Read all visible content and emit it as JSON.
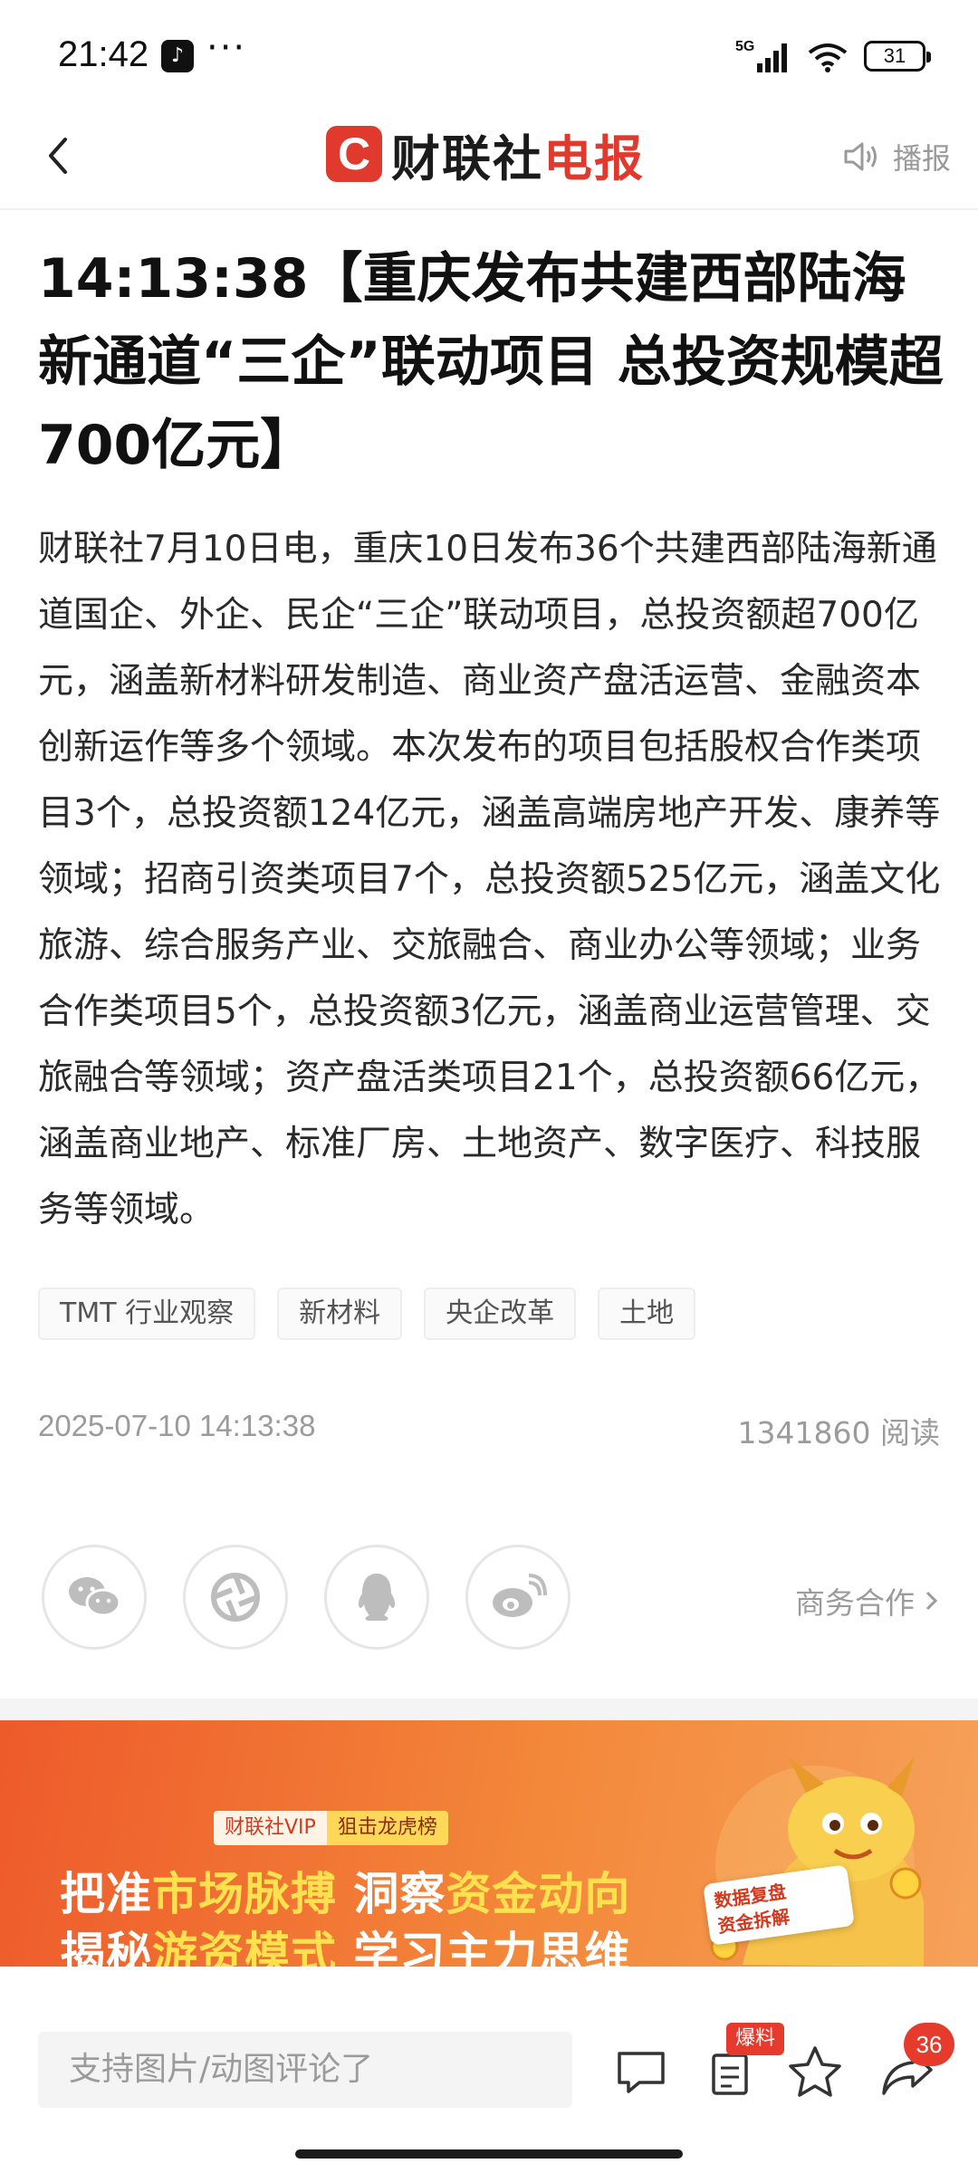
{
  "status_bar": {
    "time": "21:42",
    "tiktok_glyph": "♪",
    "dots": "···",
    "network": "5G",
    "battery": "31"
  },
  "header": {
    "logo_c": "C",
    "logo_main": "财联社",
    "logo_accent": "电报",
    "broadcast_label": "播报"
  },
  "article": {
    "title": "14:13:38【重庆发布共建西部陆海新通道“三企”联动项目 总投资规模超700亿元】",
    "body": "财联社7月10日电，重庆10日发布36个共建西部陆海新通道国企、外企、民企“三企”联动项目，总投资额超700亿元，涵盖新材料研发制造、商业资产盘活运营、金融资本创新运作等多个领域。本次发布的项目包括股权合作类项目3个，总投资额124亿元，涵盖高端房地产开发、康养等领域；招商引资类项目7个，总投资额525亿元，涵盖文化旅游、综合服务产业、交旅融合、商业办公等领域；业务合作类项目5个，总投资额3亿元，涵盖商业运营管理、交旅融合等领域；资产盘活类项目21个，总投资额66亿元，涵盖商业地产、标准厂房、土地资产、数字医疗、科技服务等领域。",
    "tags": [
      "TMT 行业观察",
      "新材料",
      "央企改革",
      "土地"
    ],
    "datetime": "2025-07-10 14:13:38",
    "reads": "1341860 阅读",
    "business_link": "商务合作"
  },
  "share": [
    "wechat-icon",
    "moments-icon",
    "qq-icon",
    "weibo-icon"
  ],
  "banner": {
    "badge_left": "财联社VIP",
    "badge_right": "狙击龙虎榜",
    "line1_a": "把准",
    "line1_b": "市场脉搏",
    "line1_c": " 洞察",
    "line1_d": "资金动向",
    "line2_a": "揭秘",
    "line2_b": "游资模式",
    "line2_c": " 学习主力思维",
    "card_1": "数据复盘",
    "card_2": "资金拆解"
  },
  "bottom_bar": {
    "comment_placeholder": "支持图片/动图评论了",
    "baoliao_label": "爆料",
    "share_count": "36"
  },
  "colors": {
    "brand_red": "#e03a2e",
    "banner_orange": "#ee5a2b",
    "banner_yellow": "#ffe14f",
    "muted_gray": "#9b9b9b"
  }
}
